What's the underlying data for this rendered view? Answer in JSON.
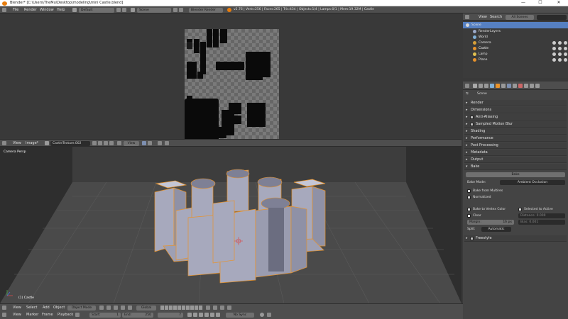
{
  "window": {
    "title": "Blender* [C:\\Users\\TheMu\\Desktop\\modeling\\mini Castle.blend]",
    "minimize": "—",
    "maximize": "☐",
    "close": "✕"
  },
  "info_header": {
    "menus": [
      "File",
      "Render",
      "Window",
      "Help"
    ],
    "layout": "Default",
    "scene": "Scene",
    "engine": "Blender Render",
    "stats": "v2.76 | Verts:256 | Faces:265 | Tris:434 | Objects:1/4 | Lamps:0/1 | Mem:19.32M | Castle"
  },
  "image_editor": {
    "menus": [
      "View",
      "Image*"
    ],
    "image_name": "CastleTexture.002",
    "view": "View"
  },
  "viewport": {
    "label": "Camera Persp",
    "object_label": "(1) Castle",
    "menus": [
      "View",
      "Select",
      "Add",
      "Object"
    ],
    "mode": "Object Mode",
    "pivot": "Global"
  },
  "timeline": {
    "menus": [
      "View",
      "Marker",
      "Frame",
      "Playback"
    ],
    "start_label": "Start:",
    "start_value": "1",
    "end_label": "End:",
    "end_value": "250",
    "current": "7",
    "sync": "No Sync"
  },
  "outliner": {
    "menus": [
      "View",
      "Search"
    ],
    "filter": "All Scenes",
    "items": [
      {
        "label": "Scene",
        "color": "#d8d8d8"
      },
      {
        "label": "RenderLayers",
        "color": "#9aa9c8"
      },
      {
        "label": "World",
        "color": "#7fb0d8"
      },
      {
        "label": "Camera",
        "color": "#d8a03a"
      },
      {
        "label": "Castle",
        "color": "#e8932b"
      },
      {
        "label": "Lamp",
        "color": "#e0c050"
      },
      {
        "label": "Plane",
        "color": "#e8932b"
      }
    ]
  },
  "properties": {
    "scene_label": "Scene",
    "panels": [
      "Render",
      "Dimensions",
      "Anti-Aliasing",
      "Sampled Motion Blur",
      "Shading",
      "Performance",
      "Post Processing",
      "Metadata",
      "Output",
      "Bake"
    ],
    "bake": {
      "bake_button": "Bake",
      "bake_mode_label": "Bake Mode:",
      "bake_mode_value": "Ambient Occlusion",
      "bake_from_multires": "Bake from Multires",
      "normalized": "Normalized",
      "bake_to_vertex_color": "Bake to Vertex Color",
      "selected_to_active": "Selected to Active",
      "clear": "Clear",
      "distance": "Distance: 0.000",
      "margin": "Margin:",
      "margin_value": "16 px",
      "bias": "Bias: 0.001",
      "split_label": "Split:",
      "split_value": "Automatic"
    },
    "freestyle": "Freestyle"
  },
  "colors": {
    "accent": "#e87d0d",
    "selection": "#5680c2",
    "mesh": "#a7a9bd"
  }
}
